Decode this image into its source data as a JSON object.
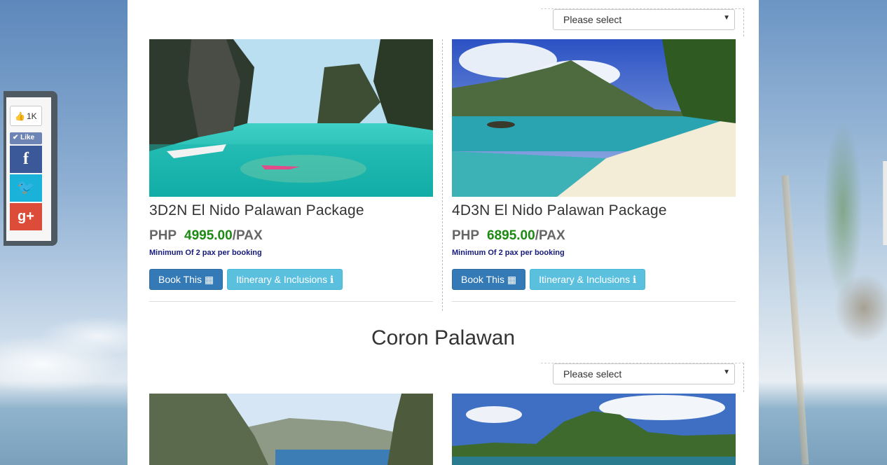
{
  "share": {
    "like_count": "1K",
    "like_label": "Like"
  },
  "sections": [
    {
      "select_value": "Please select",
      "cards": [
        {
          "title": "3D2N El Nido Palawan Package",
          "currency": "PHP",
          "price": "4995.00",
          "unit": "/PAX",
          "note": "Minimum Of 2 pax per booking",
          "book_label": "Book This",
          "itinerary_label": "Itinerary & Inclusions"
        },
        {
          "title": "4D3N El Nido Palawan Package",
          "currency": "PHP",
          "price": "6895.00",
          "unit": "/PAX",
          "note": "Minimum Of 2 pax per booking",
          "book_label": "Book This",
          "itinerary_label": "Itinerary & Inclusions"
        }
      ]
    },
    {
      "heading": "Coron Palawan",
      "select_value": "Please select"
    }
  ],
  "colors": {
    "price": "#1c8a12",
    "note": "#151a7c",
    "book_button": "#337ab7",
    "itinerary_button": "#5bc0de",
    "facebook": "#3b5998",
    "twitter": "#1bb2d9",
    "google_plus": "#dd4b39"
  },
  "icons": [
    "thumbs-up-icon",
    "check-icon",
    "facebook-icon",
    "twitter-icon",
    "google-plus-icon",
    "calendar-icon",
    "info-icon",
    "chevron-down-icon"
  ]
}
